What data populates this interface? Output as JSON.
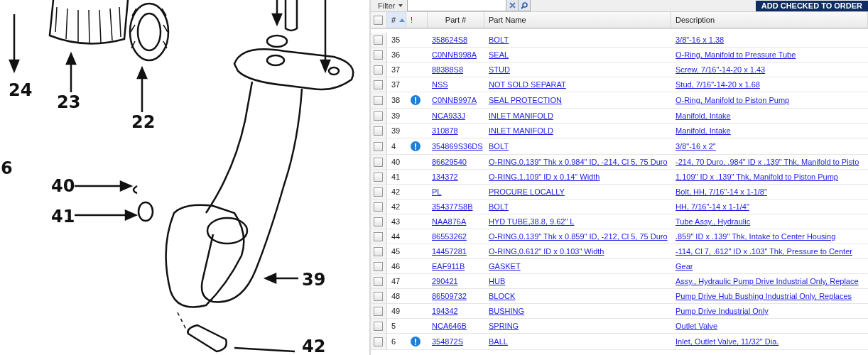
{
  "diagram": {
    "callouts": [
      "24",
      "23",
      "22",
      "6",
      "40",
      "41",
      "39",
      "42"
    ]
  },
  "toolbar": {
    "filter_label": "Filter",
    "add_button": "ADD CHECKED TO ORDER"
  },
  "table": {
    "select_all_checked": false,
    "columns": [
      {
        "label": "#",
        "sorted": true
      },
      {
        "label": "!",
        "sorted": false
      },
      {
        "label": "Part #",
        "sorted": false
      },
      {
        "label": "Part Name",
        "sorted": false
      },
      {
        "label": "Description",
        "sorted": false
      }
    ],
    "rows": [
      {
        "checked": false,
        "num": "35",
        "alert": false,
        "part": "358624S8",
        "name": "BOLT",
        "description": "3/8\"-16 x 1.38"
      },
      {
        "checked": false,
        "num": "36",
        "alert": false,
        "part": "C0NNB998A",
        "name": "SEAL",
        "description": "O-Ring, Manifold to Pressure Tube"
      },
      {
        "checked": false,
        "num": "37",
        "alert": false,
        "part": "88388S8",
        "name": "STUD",
        "description": "Screw, 7/16\"-14-20 x 1.43"
      },
      {
        "checked": false,
        "num": "37",
        "alert": false,
        "part": "NSS",
        "name": "NOT SOLD SEPARAT",
        "description": "Stud, 7/16\"-14-20 x 1.68"
      },
      {
        "checked": false,
        "num": "38",
        "alert": true,
        "part": "C0NNB997A",
        "name": "SEAL PROTECTION",
        "description": "O-Ring, Manifold to Piston Pump"
      },
      {
        "checked": false,
        "num": "39",
        "alert": false,
        "part": "NCA933J",
        "name": "INLET MANIFOLD",
        "description": "Manifold, Intake"
      },
      {
        "checked": false,
        "num": "39",
        "alert": false,
        "part": "310878",
        "name": "INLET MANIFOLD",
        "description": "Manifold, Intake"
      },
      {
        "checked": false,
        "num": "4",
        "alert": true,
        "part": "354869S36DS",
        "name": "BOLT",
        "description": "3/8\"-16 x 2\""
      },
      {
        "checked": false,
        "num": "40",
        "alert": false,
        "part": "86629540",
        "name": "O-RING,0.139\" Thk x 0.984\" ID, -214, Cl 5, 75 Duro",
        "description": "-214, 70 Duro, .984\" ID x .139\" Thk, Manifold to Pisto"
      },
      {
        "checked": false,
        "num": "41",
        "alert": false,
        "part": "134372",
        "name": "O-RING,1.109\" ID x 0.14\" Width",
        "description": "1.109\" ID x .139\" Thk, Manifold to Piston Pump"
      },
      {
        "checked": false,
        "num": "42",
        "alert": false,
        "part": "PL",
        "name": "PROCURE LOCALLY",
        "description": "Bolt, HH, 7/16\"-14 x 1-1/8\""
      },
      {
        "checked": false,
        "num": "42",
        "alert": false,
        "part": "354377S8B",
        "name": "BOLT",
        "description": "HH, 7/16\"-14 x 1-1/4\""
      },
      {
        "checked": false,
        "num": "43",
        "alert": false,
        "part": "NAA876A",
        "name": "HYD TUBE,38.8, 9.62\" L",
        "description": "Tube Assy., Hydraulic"
      },
      {
        "checked": false,
        "num": "44",
        "alert": false,
        "part": "86553262",
        "name": "O-RING,0.139\" Thk x 0.859\" ID, -212, Cl 5, 75 Duro",
        "description": ".859\" ID x .139\" Thk, Intake to Center Housing"
      },
      {
        "checked": false,
        "num": "45",
        "alert": false,
        "part": "14457281",
        "name": "O-RING,0.612\" ID x 0.103\" Width",
        "description": "-114, Cl 7, .612\" ID x .103\" Thk, Pressure to Center"
      },
      {
        "checked": false,
        "num": "46",
        "alert": false,
        "part": "EAF911B",
        "name": "GASKET",
        "description": "Gear"
      },
      {
        "checked": false,
        "num": "47",
        "alert": false,
        "part": "290421",
        "name": "HUB",
        "description": "Assy., Hydraulic Pump Drive Industrial Only, Replace"
      },
      {
        "checked": false,
        "num": "48",
        "alert": false,
        "part": "86509732",
        "name": "BLOCK",
        "description": "Pump Drive Hub Bushing Industrial Only, Replaces"
      },
      {
        "checked": false,
        "num": "49",
        "alert": false,
        "part": "194342",
        "name": "BUSHING",
        "description": "Pump Drive Industrial Only"
      },
      {
        "checked": false,
        "num": "5",
        "alert": false,
        "part": "NCA646B",
        "name": "SPRING",
        "description": "Outlet Valve"
      },
      {
        "checked": false,
        "num": "6",
        "alert": true,
        "part": "354872S",
        "name": "BALL",
        "description": "Inlet, Outlet Valve, 11/32\" Dia."
      }
    ]
  }
}
